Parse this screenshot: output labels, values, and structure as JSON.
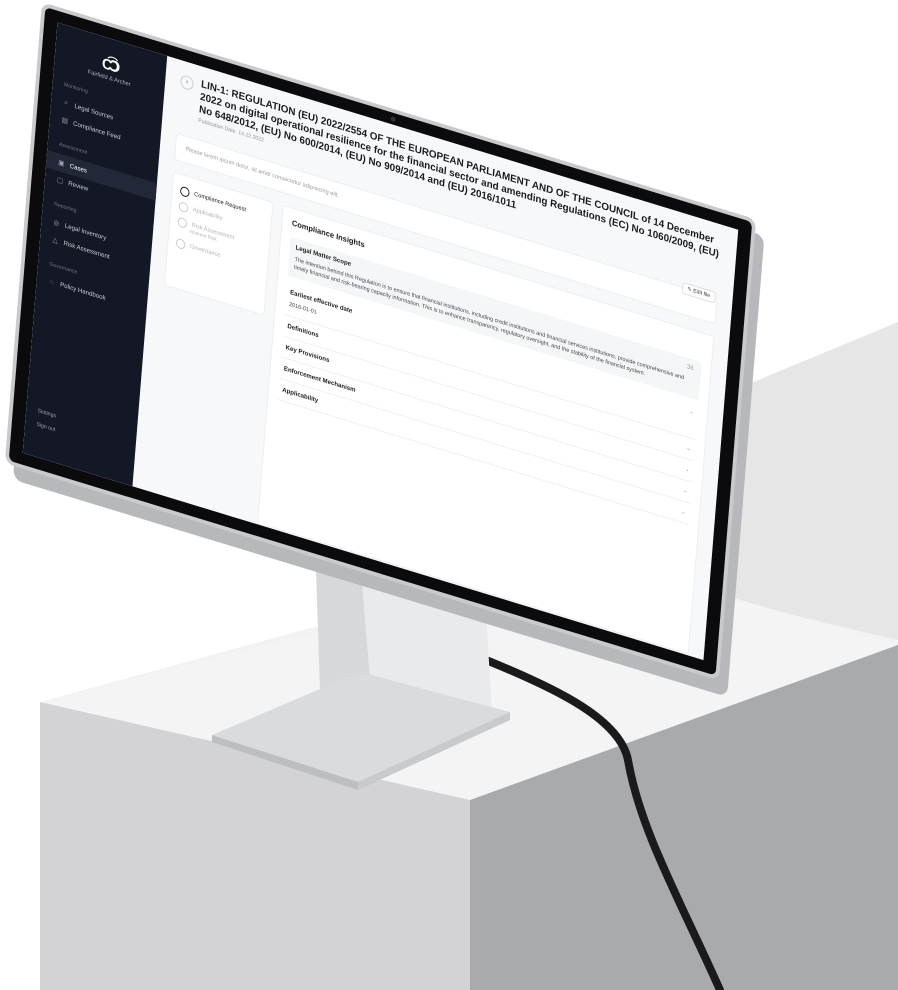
{
  "sidebar": {
    "logo_glyph": "C͡Ↄ",
    "brand": "Fairfield & Archer",
    "sections": [
      {
        "label": "Monitoring",
        "items": [
          {
            "icon": "search-icon",
            "glyph": "⌕",
            "label": "Legal Sources"
          },
          {
            "icon": "feed-icon",
            "glyph": "▤",
            "label": "Compliance Feed"
          }
        ]
      },
      {
        "label": "Assessment",
        "items": [
          {
            "icon": "cases-icon",
            "glyph": "▣",
            "label": "Cases",
            "active": true
          },
          {
            "icon": "review-icon",
            "glyph": "▢",
            "label": "Review"
          }
        ]
      },
      {
        "label": "Reporting",
        "items": [
          {
            "icon": "inventory-icon",
            "glyph": "◎",
            "label": "Legal Inventory"
          },
          {
            "icon": "warning-icon",
            "glyph": "△",
            "label": "Risk Assessment"
          }
        ]
      },
      {
        "label": "Governance",
        "items": [
          {
            "icon": "policy-icon",
            "glyph": "◌",
            "label": "Policy Handbook"
          }
        ]
      }
    ],
    "settings": "Settings",
    "sign_out": "Sign out"
  },
  "header": {
    "back_glyph": "‹",
    "title": "LIN-1: REGULATION (EU) 2022/2554 OF THE EUROPEAN PARLIAMENT AND OF THE COUNCIL of 14 December 2022 on digital operational resilience for the financial sector and amending Regulations (EC) No 1060/2009, (EU) No 648/2012, (EU) No 600/2014, (EU) No 909/2014 and (EU) 2016/1011",
    "publication_date": "Publication Date: 14.12.2022",
    "edit_label": "Edit file"
  },
  "description_placeholder": "Please lorem ipsum dolor, sit amet consectetur adipisicing elit.",
  "steps": [
    {
      "label": "Compliance Request",
      "active": true
    },
    {
      "label": "Applicability",
      "active": false
    },
    {
      "label": "Risk Assessment",
      "sub": "Inherent Risk",
      "active": false
    },
    {
      "label": "Governance",
      "active": false
    }
  ],
  "insights": {
    "title": "Compliance Insights",
    "scope_label": "Legal Matter Scope",
    "scope_count": "36",
    "scope_text": "The intention behind this Regulation is to ensure that financial institutions, including credit institutions and financial services institutions, provide comprehensive and timely financial and risk-bearing capacity information. This is to enhance transparency, regulatory oversight, and the stability of the financial system.",
    "effective_label": "Earliest effective date",
    "effective_value": "2016-01-01",
    "sections": [
      "Definitions",
      "Key Provisions",
      "Enforcement Mechanism",
      "Applicability"
    ]
  }
}
